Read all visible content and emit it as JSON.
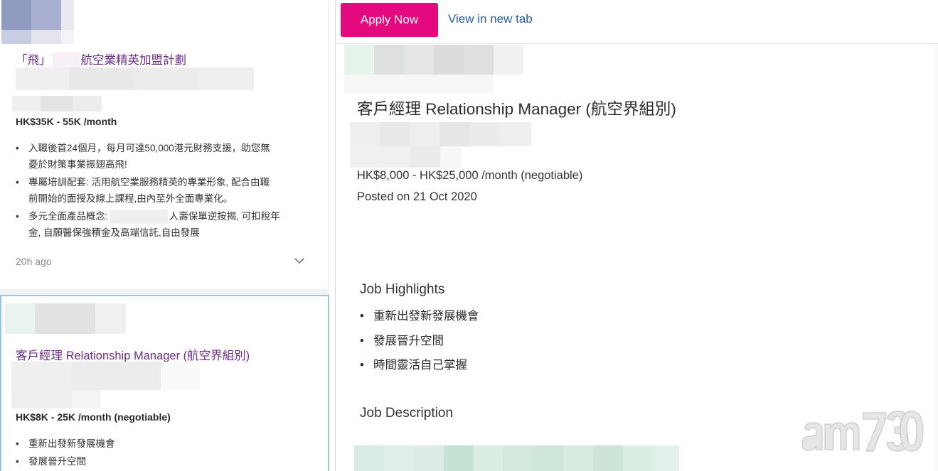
{
  "left": {
    "card1": {
      "title": "「飛」 航空業精英加盟計劃",
      "title_part1": "「飛」",
      "title_part2": "航空業精英加盟計劃",
      "salary": "HK$35K - 55K /month",
      "bullets": [
        "入職後首24個月，每月可達50,000港元財務支援，助您無憂於財策事業振翅高飛!",
        "專屬培訓配套: 活用航空業服務精英的專業形象, 配合由職前開始的面授及線上課程,由內至外全面專業化。",
        "多元全面產品概念: 人壽保單逆按揭, 可扣稅年金, 自願醫保強積金及高端信託,自由發展"
      ],
      "bullet1_line1": "入職後首24個月，每月可達50,000港元財務支援，助您無",
      "bullet1_line2": "憂於財策事業振翅高飛!",
      "bullet2_line1": "專屬培訓配套: 活用航空業服務精英的專業形象, 配合由職",
      "bullet2_line2": "前開始的面授及線上課程,由內至外全面專業化。",
      "bullet3_line1a": "多元全面產品概念:",
      "bullet3_line1b": "人壽保單逆按揭, 可扣稅年",
      "bullet3_line2": "金, 自願醫保強積金及高端信託,自由發展",
      "posted_ago": "20h ago",
      "expand_icon": "chevron-down-icon"
    },
    "card2": {
      "title": "客戶經理 Relationship Manager (航空界組別)",
      "salary": "HK$8K - 25K /month (negotiable)",
      "bullets": [
        "重新出發新發展機會",
        "發展晉升空間"
      ]
    }
  },
  "right": {
    "apply_label": "Apply Now",
    "view_tab_label": "View in new tab",
    "job_title": "客戶經理 Relationship Manager (航空界組別)",
    "salary": "HK$8,000 - HK$25,000 /month (negotiable)",
    "posted": "Posted on 21 Oct 2020",
    "highlights_heading": "Job Highlights",
    "highlights": [
      "重新出發新發展機會",
      "發展晉升空間",
      "時間靈活自己掌握"
    ],
    "description_heading": "Job Description"
  },
  "colors": {
    "accent": "#e5097f",
    "link": "#2a5d9c",
    "card_title": "#6b2d86",
    "selected_border": "#9cc1e3"
  }
}
